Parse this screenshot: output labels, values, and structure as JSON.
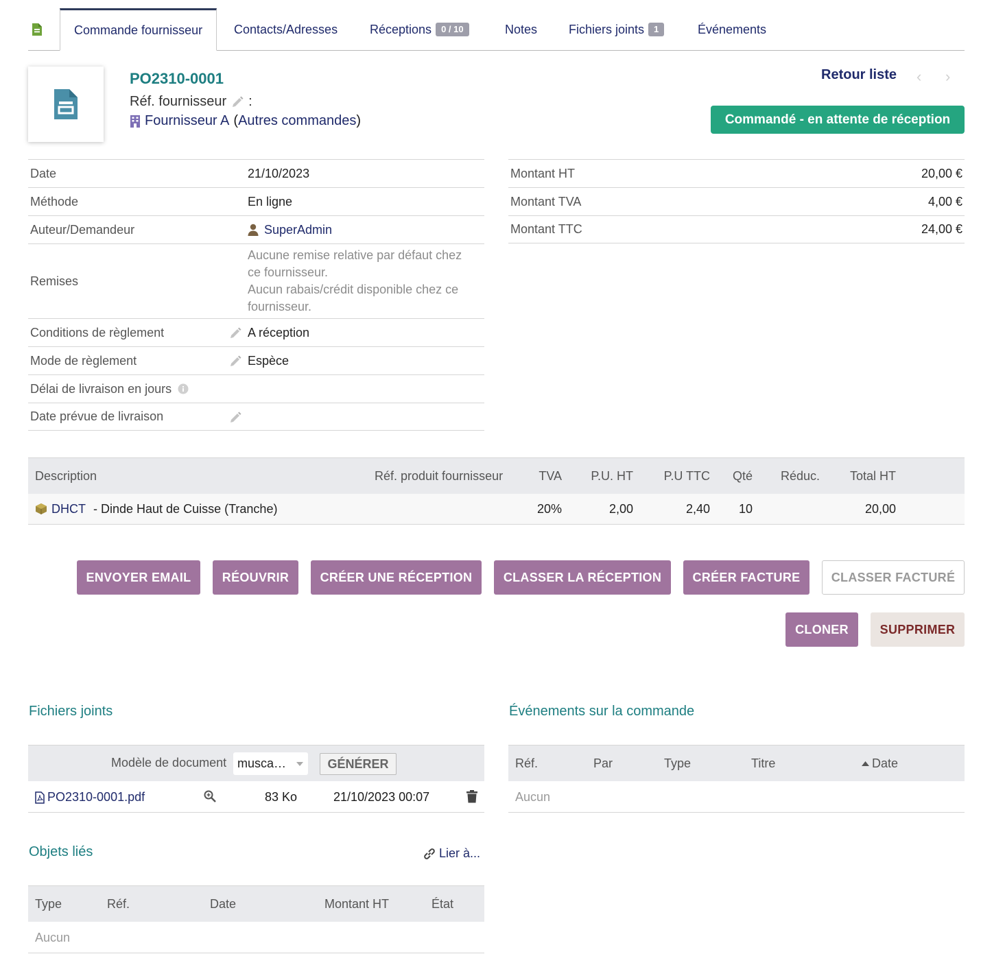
{
  "tabs": [
    {
      "label": "Commande fournisseur"
    },
    {
      "label": "Contacts/Adresses"
    },
    {
      "label": "Réceptions",
      "badge": "0 / 10"
    },
    {
      "label": "Notes"
    },
    {
      "label": "Fichiers joints",
      "badge": "1"
    },
    {
      "label": "Événements"
    }
  ],
  "header": {
    "ref": "PO2310-0001",
    "supplier_ref_label": "Réf. fournisseur",
    "supplier_ref_sep": ":",
    "supplier_name": "Fournisseur A",
    "other_orders": "Autres commandes",
    "back_list": "Retour liste",
    "status": "Commandé - en attente de réception"
  },
  "info_left": {
    "date_label": "Date",
    "date_value": "21/10/2023",
    "method_label": "Méthode",
    "method_value": "En ligne",
    "author_label": "Auteur/Demandeur",
    "author_value": "SuperAdmin",
    "discount_label": "Remises",
    "discount_line1": "Aucune remise relative par défaut chez ce fournisseur.",
    "discount_line2": "Aucun rabais/crédit disponible chez ce fournisseur.",
    "payment_terms_label": "Conditions de règlement",
    "payment_terms_value": "A réception",
    "payment_mode_label": "Mode de règlement",
    "payment_mode_value": "Espèce",
    "delivery_delay_label": "Délai de livraison en jours",
    "delivery_date_label": "Date prévue de livraison"
  },
  "info_right": {
    "ht_label": "Montant HT",
    "ht_value": "20,00 €",
    "tva_label": "Montant TVA",
    "tva_value": "4,00 €",
    "ttc_label": "Montant TTC",
    "ttc_value": "24,00 €"
  },
  "lines": {
    "headers": {
      "description": "Description",
      "supplier_ref": "Réf. produit fournisseur",
      "tva": "TVA",
      "pu_ht": "P.U. HT",
      "pu_ttc": "P.U TTC",
      "qty": "Qté",
      "discount": "Réduc.",
      "total_ht": "Total HT"
    },
    "rows": [
      {
        "product_ref": "DHCT",
        "product_label": " - Dinde Haut de Cuisse (Tranche)",
        "tva": "20%",
        "pu_ht": "2,00",
        "pu_ttc": "2,40",
        "qty": "10",
        "total_ht": "20,00"
      }
    ]
  },
  "actions": {
    "send_email": "ENVOYER EMAIL",
    "reopen": "RÉOUVRIR",
    "create_reception": "CRÉER UNE RÉCEPTION",
    "classify_reception": "CLASSER LA RÉCEPTION",
    "create_invoice": "CRÉER FACTURE",
    "classify_billed": "CLASSER FACTURÉ",
    "clone": "CLONER",
    "delete": "SUPPRIMER"
  },
  "files": {
    "title": "Fichiers joints",
    "model_label": "Modèle de document",
    "model_value": "musca…",
    "generate": "GÉNÉRER",
    "rows": [
      {
        "name": "PO2310-0001.pdf",
        "size": "83 Ko",
        "date": "21/10/2023 00:07"
      }
    ]
  },
  "events": {
    "title": "Événements sur la commande",
    "headers": {
      "ref": "Réf.",
      "by": "Par",
      "type": "Type",
      "title": "Titre",
      "date": "Date"
    },
    "empty": "Aucun"
  },
  "linked": {
    "title": "Objets liés",
    "link_to": "Lier à...",
    "headers": {
      "type": "Type",
      "ref": "Réf.",
      "date": "Date",
      "amount": "Montant HT",
      "state": "État"
    },
    "empty": "Aucun"
  },
  "colors": {
    "accent_teal": "#1d7e81",
    "status_green": "#25a580",
    "button_purple": "#a0749e",
    "link_navy": "#1f2a6b"
  }
}
